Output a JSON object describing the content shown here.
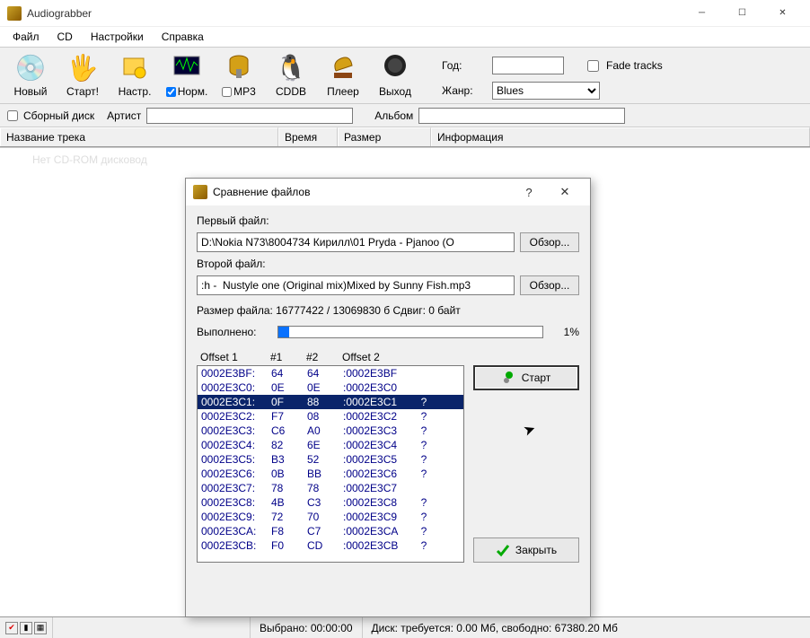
{
  "app": {
    "title": "Audiograbber"
  },
  "menu": [
    "Файл",
    "CD",
    "Настройки",
    "Справка"
  ],
  "toolbar": {
    "new": "Новый",
    "start": "Старт!",
    "settings": "Настр.",
    "norm": "Норм.",
    "mp3": "MP3",
    "cddb": "CDDB",
    "player": "Плеер",
    "exit": "Выход"
  },
  "extras": {
    "year_label": "Год:",
    "year_value": "",
    "genre_label": "Жанр:",
    "genre_value": "Blues",
    "fade_label": "Fade tracks"
  },
  "filters": {
    "compilation_label": "Сборный диск",
    "artist_label": "Артист",
    "artist_value": "",
    "album_label": "Альбом",
    "album_value": ""
  },
  "columns": {
    "name": "Название трека",
    "time": "Время",
    "size": "Размер",
    "info": "Информация"
  },
  "ghost_message": "Нет CD-ROM дисковод",
  "status": {
    "selected_label": "Выбрано:",
    "selected_value": "00:00:00",
    "disk_text": "Диск: требуется: 0.00 Мб, свободно: 67380.20 Мб"
  },
  "dialog": {
    "title": "Сравнение файлов",
    "help_btn": "?",
    "file1_label": "Первый файл:",
    "file1_value": "D:\\Nokia N73\\8004734 Кирилл\\01 Pryda - Pjanoo (O",
    "file2_label": "Второй файл:",
    "file2_value": ":h -  Nustyle one (Original mix)Mixed by Sunny Fish.mp3",
    "browse": "Обзор...",
    "size_line": "Размер файла: 16777422 / 13069830 б   Сдвиг: 0   байт",
    "done_label": "Выполнено:",
    "done_pct": "1%",
    "hex_headers": {
      "offset1": "Offset 1",
      "n1": "#1",
      "n2": "#2",
      "offset2": "Offset 2"
    },
    "start_btn": "Старт",
    "close_btn": "Закрыть",
    "rows": [
      {
        "o1": "0002E3BF:",
        "v1": "64",
        "v2": "64",
        "o2": ":0002E3BF",
        "q": "",
        "sel": false
      },
      {
        "o1": "0002E3C0:",
        "v1": "0E",
        "v2": "0E",
        "o2": ":0002E3C0",
        "q": "",
        "sel": false
      },
      {
        "o1": "0002E3C1:",
        "v1": "0F",
        "v2": "88",
        "o2": ":0002E3C1",
        "q": "?",
        "sel": true
      },
      {
        "o1": "0002E3C2:",
        "v1": "F7",
        "v2": "08",
        "o2": ":0002E3C2",
        "q": "?",
        "sel": false
      },
      {
        "o1": "0002E3C3:",
        "v1": "C6",
        "v2": "A0",
        "o2": ":0002E3C3",
        "q": "?",
        "sel": false
      },
      {
        "o1": "0002E3C4:",
        "v1": "82",
        "v2": "6E",
        "o2": ":0002E3C4",
        "q": "?",
        "sel": false
      },
      {
        "o1": "0002E3C5:",
        "v1": "B3",
        "v2": "52",
        "o2": ":0002E3C5",
        "q": "?",
        "sel": false
      },
      {
        "o1": "0002E3C6:",
        "v1": "0B",
        "v2": "BB",
        "o2": ":0002E3C6",
        "q": "?",
        "sel": false
      },
      {
        "o1": "0002E3C7:",
        "v1": "78",
        "v2": "78",
        "o2": ":0002E3C7",
        "q": "",
        "sel": false
      },
      {
        "o1": "0002E3C8:",
        "v1": "4B",
        "v2": "C3",
        "o2": ":0002E3C8",
        "q": "?",
        "sel": false
      },
      {
        "o1": "0002E3C9:",
        "v1": "72",
        "v2": "70",
        "o2": ":0002E3C9",
        "q": "?",
        "sel": false
      },
      {
        "o1": "0002E3CA:",
        "v1": "F8",
        "v2": "C7",
        "o2": ":0002E3CA",
        "q": "?",
        "sel": false
      },
      {
        "o1": "0002E3CB:",
        "v1": "F0",
        "v2": "CD",
        "o2": ":0002E3CB",
        "q": "?",
        "sel": false
      }
    ]
  }
}
